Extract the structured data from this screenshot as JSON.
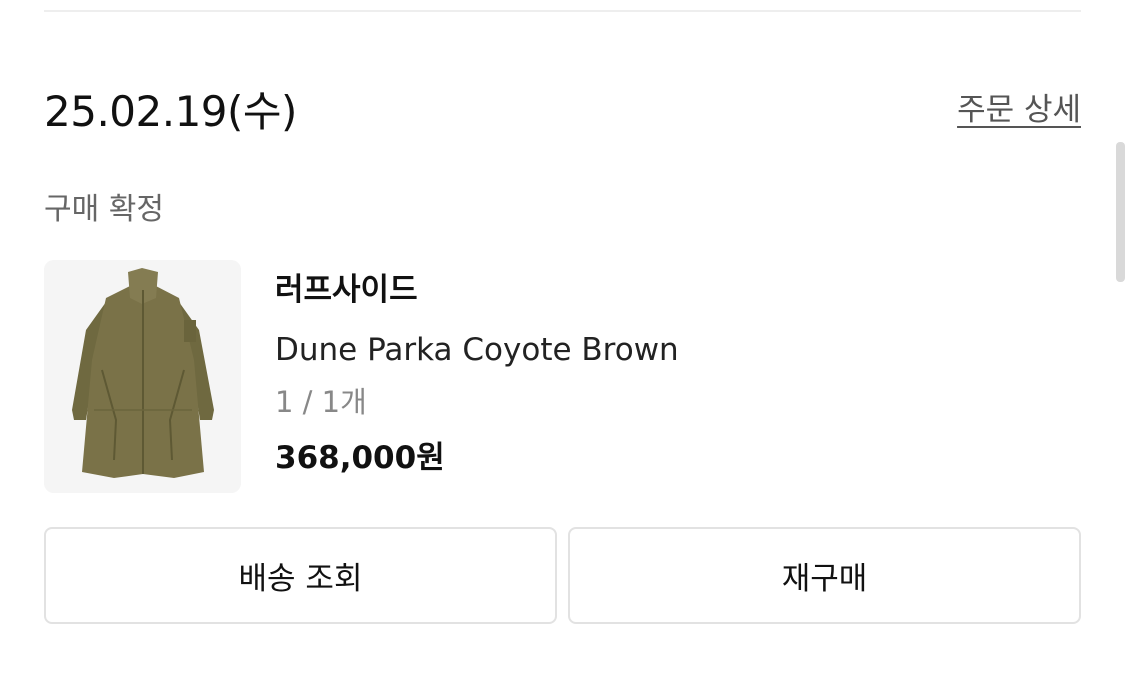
{
  "order": {
    "date": "25.02.19(수)",
    "detail_link": "주문 상세",
    "status": "구매 확정"
  },
  "product": {
    "brand": "러프사이드",
    "name": "Dune Parka Coyote Brown",
    "quantity": "1 / 1개",
    "price": "368,000원",
    "image_icon": "parka-image"
  },
  "actions": {
    "track_label": "배송 조회",
    "rebuy_label": "재구매"
  },
  "colors": {
    "parka": "#7a7248",
    "thumb_bg": "#f5f5f5"
  }
}
